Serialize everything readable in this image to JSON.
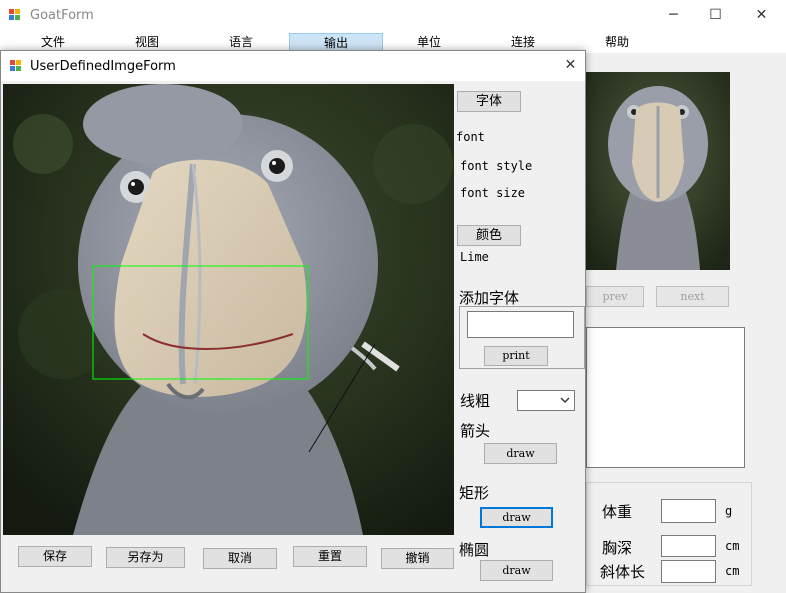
{
  "main_window": {
    "title": "GoatForm",
    "minimize_glyph": "─",
    "maximize_glyph": "☐",
    "close_glyph": "✕",
    "menu": [
      "文件",
      "视图",
      "语言",
      "输出",
      "单位",
      "连接",
      "帮助"
    ],
    "active_menu": "输出",
    "prev_label": "prev",
    "next_label": "next",
    "measure": {
      "weight_label": "体重",
      "weight_unit": "g",
      "chest_label": "胸深",
      "chest_unit": "cm",
      "oblique_label": "斜体长",
      "oblique_unit": "cm"
    }
  },
  "dialog": {
    "title": "UserDefinedImgeForm",
    "close_glyph": "✕",
    "font_button": "字体",
    "font_label": "font",
    "font_style_label": "font style",
    "font_size_label": "font size",
    "color_button": "颜色",
    "color_value": "Lime",
    "add_text_label": "添加字体",
    "add_text_value": "",
    "print_button": "print",
    "line_width_label": "线粗",
    "line_width_value": "",
    "arrow_label": "箭头",
    "arrow_draw": "draw",
    "rect_label": "矩形",
    "rect_draw": "draw",
    "ellipse_label": "椭圆",
    "ellipse_draw": "draw",
    "bottom_buttons": [
      "保存",
      "另存为",
      "取消",
      "重置",
      "撤销"
    ],
    "rect_color": "#00ff00"
  }
}
